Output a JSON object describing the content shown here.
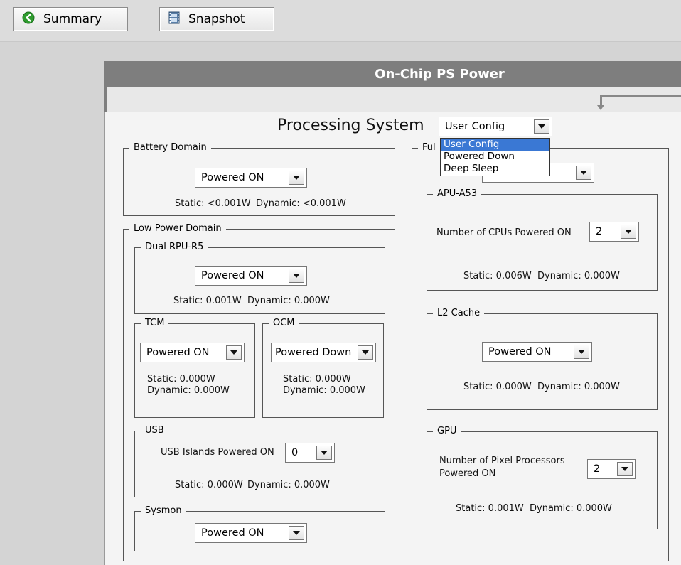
{
  "toolbar": {
    "summary_label": "Summary",
    "snapshot_label": "Snapshot",
    "summary_icon": "back-arrow-icon",
    "snapshot_icon": "film-icon"
  },
  "panel": {
    "title": "On-Chip PS Power"
  },
  "ps": {
    "title": "Processing System",
    "config_value": "User Config",
    "config_options": [
      "User Config",
      "Powered Down",
      "Deep Sleep"
    ]
  },
  "battery": {
    "legend": "Battery Domain",
    "value": "Powered ON",
    "static": "Static: <0.001W",
    "dynamic": "Dynamic: <0.001W"
  },
  "lowpower": {
    "legend": "Low Power Domain",
    "rpu": {
      "legend": "Dual RPU-R5",
      "value": "Powered ON",
      "static": "Static: 0.001W",
      "dynamic": "Dynamic: 0.000W"
    },
    "tcm": {
      "legend": "TCM",
      "value": "Powered ON",
      "static": "Static: 0.000W",
      "dynamic": "Dynamic: 0.000W"
    },
    "ocm": {
      "legend": "OCM",
      "value": "Powered Down",
      "static": "Static: 0.000W",
      "dynamic": "Dynamic: 0.000W"
    },
    "usb": {
      "legend": "USB",
      "label": "USB Islands Powered ON",
      "value": "0",
      "static": "Static: 0.000W",
      "dynamic": "Dynamic: 0.000W"
    },
    "sysmon": {
      "legend": "Sysmon",
      "value": "Powered ON"
    }
  },
  "fullpower": {
    "legend": "Ful",
    "apu": {
      "legend": "APU-A53",
      "label": "Number of CPUs Powered ON",
      "value": "2",
      "static": "Static: 0.006W",
      "dynamic": "Dynamic: 0.000W"
    },
    "l2": {
      "legend": "L2 Cache",
      "value": "Powered ON",
      "static": "Static: 0.000W",
      "dynamic": "Dynamic: 0.000W"
    },
    "gpu": {
      "legend": "GPU",
      "label_line1": "Number of Pixel Processors",
      "label_line2": "Powered ON",
      "value": "2",
      "static": "Static: 0.001W",
      "dynamic": "Dynamic: 0.000W"
    }
  }
}
